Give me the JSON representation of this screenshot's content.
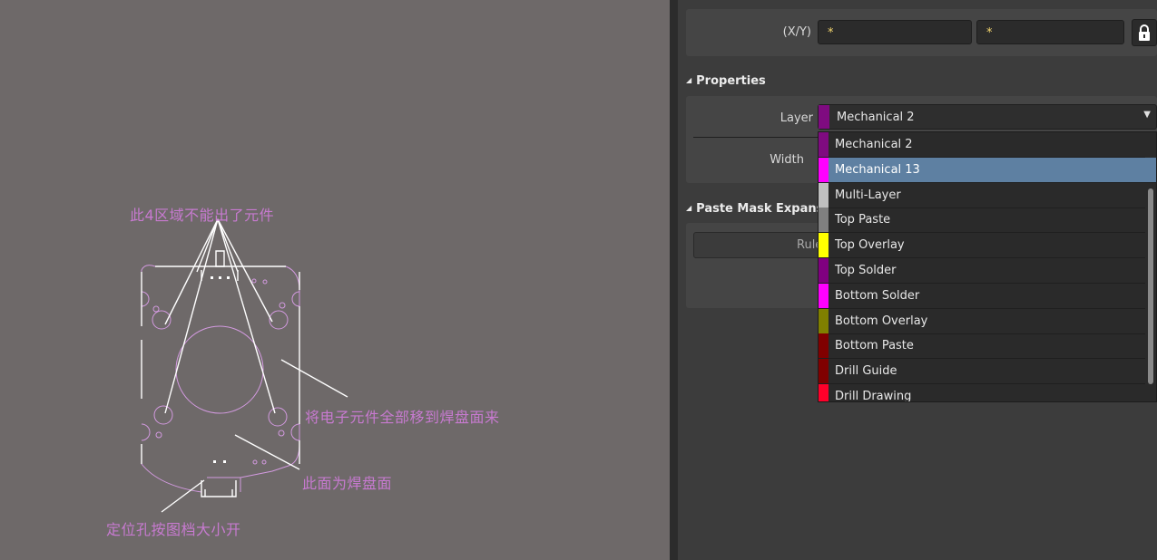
{
  "canvas": {
    "annotations": {
      "no_components_zone": "此4区域不能出了元件",
      "move_components": "将电子元件全部移到焊盘面来",
      "solder_side": "此面为焊盘面",
      "mounting_holes": "定位孔按图档大小开"
    }
  },
  "panel": {
    "location": {
      "xy_label": "(X/Y)",
      "x_value": "*",
      "y_value": "*"
    },
    "properties": {
      "title": "Properties",
      "layer_label": "Layer",
      "layer_value": "Mechanical 2",
      "layer_color": "#7f0b80",
      "width_label": "Width"
    },
    "paste_mask": {
      "title": "Paste Mask Expansio",
      "rule_button": "Rule"
    },
    "layer_dropdown": [
      {
        "label": "Mechanical 2",
        "color": "#7f0b80",
        "selected": false
      },
      {
        "label": "Mechanical 13",
        "color": "#ff00ff",
        "selected": true
      },
      {
        "label": "Multi-Layer",
        "color": "#c0c0c0",
        "selected": false
      },
      {
        "label": "Top Paste",
        "color": "#808080",
        "selected": false
      },
      {
        "label": "Top Overlay",
        "color": "#ffff00",
        "selected": false
      },
      {
        "label": "Top Solder",
        "color": "#800080",
        "selected": false
      },
      {
        "label": "Bottom Solder",
        "color": "#ff00ff",
        "selected": false
      },
      {
        "label": "Bottom Overlay",
        "color": "#808000",
        "selected": false
      },
      {
        "label": "Bottom Paste",
        "color": "#800000",
        "selected": false
      },
      {
        "label": "Drill Guide",
        "color": "#800000",
        "selected": false
      },
      {
        "label": "Drill Drawing",
        "color": "#ff002a",
        "selected": false
      }
    ]
  }
}
